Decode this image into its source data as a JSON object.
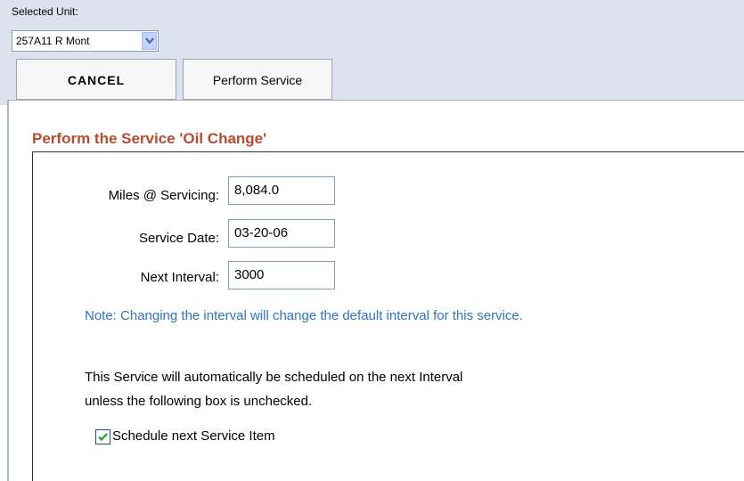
{
  "selector": {
    "label": "Selected Unit:",
    "value": "257A11 R Mont",
    "arrow_icon": "chevron-down-icon"
  },
  "tabs": {
    "cancel": "CANCEL",
    "perform": "Perform Service"
  },
  "form": {
    "title": "Perform the Service 'Oil Change'",
    "miles_label": "Miles @ Servicing:",
    "miles_value": "8,084.0",
    "date_label": "Service Date:",
    "date_value": "03-20-06",
    "interval_label": "Next Interval:",
    "interval_value": "3000",
    "note": "Note: Changing the interval will change the default interval for this service.",
    "para_line1": "This Service will automatically be scheduled on the next Interval",
    "para_line2": "unless the following box is unchecked.",
    "checkbox_label": "Schedule next Service Item",
    "checkbox_checked": true
  },
  "colors": {
    "title": "#b94a2e",
    "note": "#2e73c7",
    "topbar": "#dde3ee"
  }
}
